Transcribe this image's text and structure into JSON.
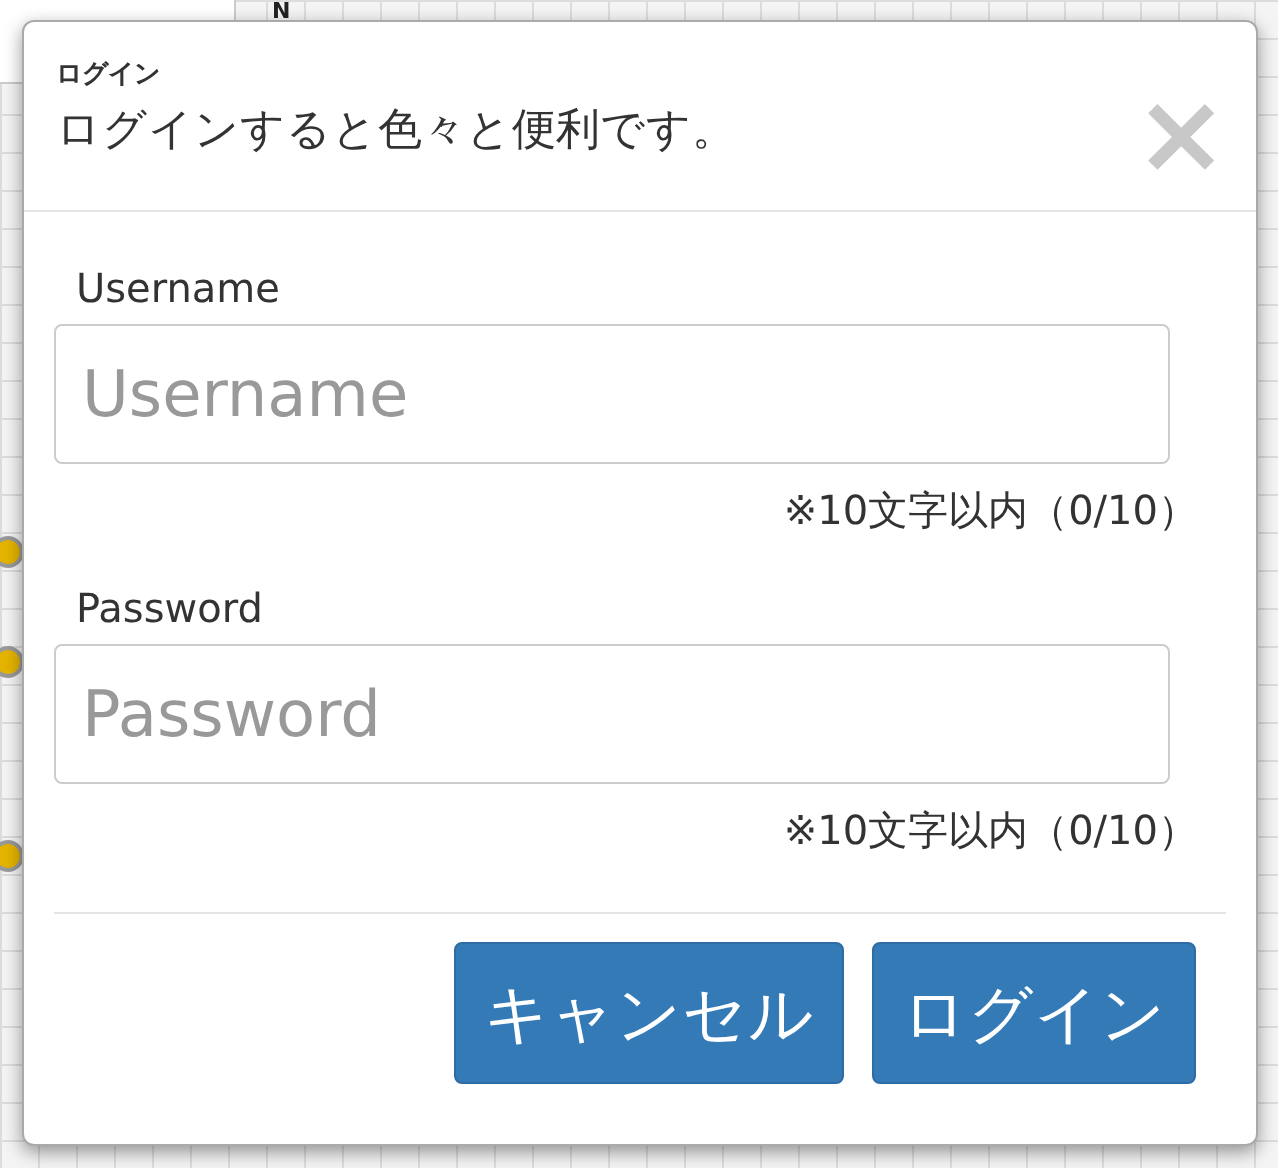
{
  "background": {
    "label": "N"
  },
  "dialog": {
    "subtitle": "ログイン",
    "title": "ログインすると色々と便利です。",
    "close": "×"
  },
  "fields": [
    {
      "label": "Username",
      "placeholder": "Username",
      "hint": "※10文字以内（0/10）"
    },
    {
      "label": "Password",
      "placeholder": "Password",
      "hint": "※10文字以内（0/10）"
    }
  ],
  "buttons": [
    "キャンセル",
    "ログイン"
  ]
}
